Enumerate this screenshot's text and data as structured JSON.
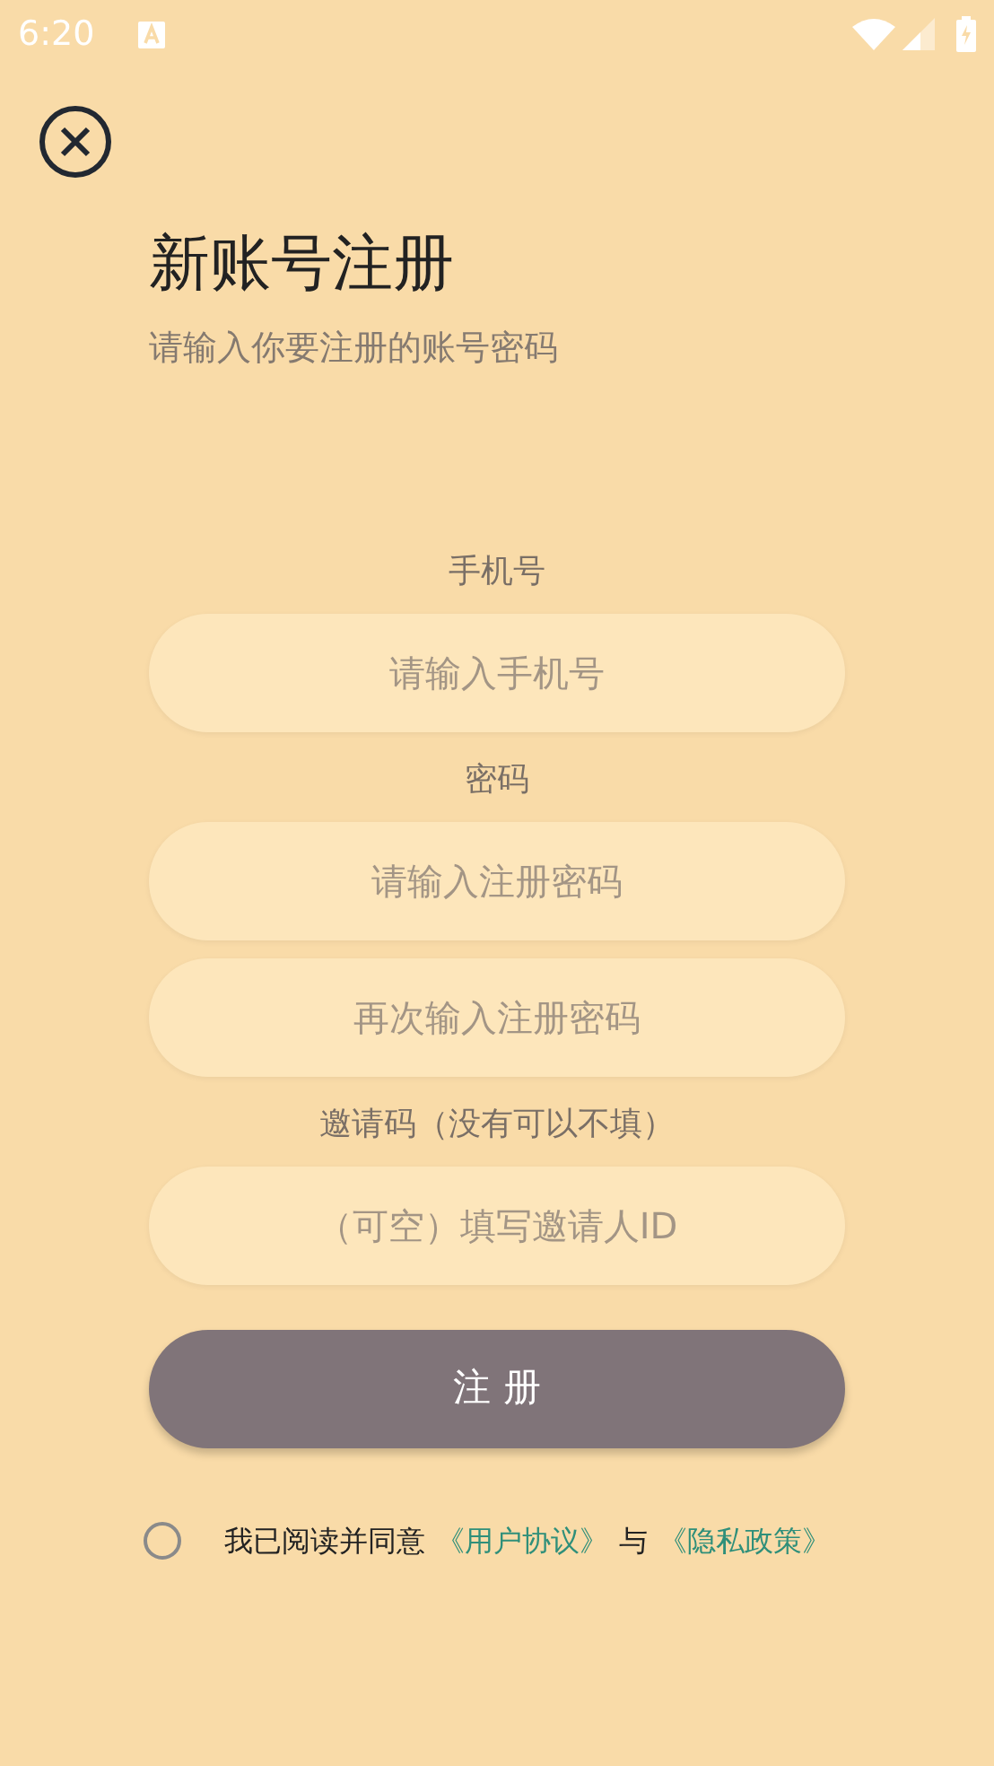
{
  "status_bar": {
    "time": "6:20"
  },
  "header": {
    "title": "新账号注册",
    "subtitle": "请输入你要注册的账号密码"
  },
  "sections": [
    {
      "label": "手机号",
      "fields": [
        {
          "placeholder": "请输入手机号"
        }
      ]
    },
    {
      "label": "密码",
      "fields": [
        {
          "placeholder": "请输入注册密码"
        },
        {
          "placeholder": "再次输入注册密码"
        }
      ]
    },
    {
      "label": "邀请码（没有可以不填）",
      "fields": [
        {
          "placeholder": "（可空）填写邀请人ID"
        }
      ]
    }
  ],
  "submit_button": "注 册",
  "agreement": {
    "checked": false,
    "parts": [
      {
        "kind": "text",
        "text": "我已阅读并同意"
      },
      {
        "kind": "link",
        "text": "《用户协议》"
      },
      {
        "kind": "text",
        "text": "与"
      },
      {
        "kind": "link",
        "text": "《隐私政策》"
      }
    ]
  }
}
